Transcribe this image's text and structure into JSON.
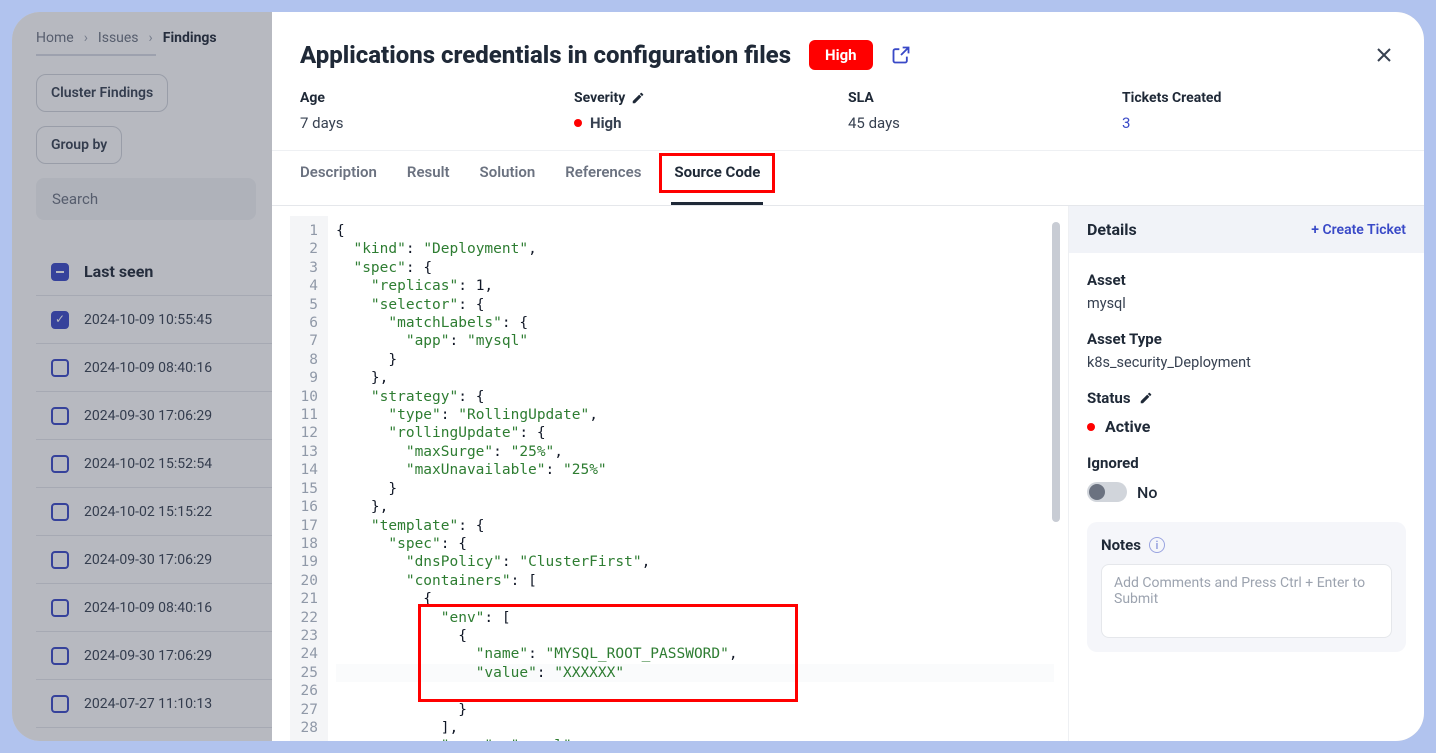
{
  "breadcrumbs": {
    "home": "Home",
    "issues": "Issues",
    "findings": "Findings"
  },
  "bg": {
    "cluster_btn": "Cluster Findings",
    "groupby_btn": "Group by",
    "search_placeholder": "Search",
    "th_lastseen": "Last seen",
    "rows": [
      "2024-10-09 10:55:45",
      "2024-10-09 08:40:16",
      "2024-09-30 17:06:29",
      "2024-10-02 15:52:54",
      "2024-10-02 15:15:22",
      "2024-09-30 17:06:29",
      "2024-10-09 08:40:16",
      "2024-09-30 17:06:29",
      "2024-07-27 11:10:13"
    ]
  },
  "panel": {
    "title": "Applications credentials in configuration files",
    "badge": "High",
    "meta": {
      "age_label": "Age",
      "age_value": "7 days",
      "sev_label": "Severity",
      "sev_value": "High",
      "sla_label": "SLA",
      "sla_value": "45 days",
      "tickets_label": "Tickets Created",
      "tickets_value": "3"
    },
    "tabs": {
      "description": "Description",
      "result": "Result",
      "solution": "Solution",
      "references": "References",
      "source": "Source Code"
    }
  },
  "sidebar": {
    "details": "Details",
    "create_ticket": "+ Create Ticket",
    "asset_label": "Asset",
    "asset_value": "mysql",
    "asset_type_label": "Asset Type",
    "asset_type_value": "k8s_security_Deployment",
    "status_label": "Status",
    "status_value": "Active",
    "ignored_label": "Ignored",
    "ignored_value": "No",
    "notes_label": "Notes",
    "notes_placeholder": "Add Comments and Press Ctrl + Enter to Submit"
  },
  "code": {
    "lines": [
      "{",
      "  \"kind\": \"Deployment\",",
      "  \"spec\": {",
      "    \"replicas\": 1,",
      "    \"selector\": {",
      "      \"matchLabels\": {",
      "        \"app\": \"mysql\"",
      "      }",
      "    },",
      "    \"strategy\": {",
      "      \"type\": \"RollingUpdate\",",
      "      \"rollingUpdate\": {",
      "        \"maxSurge\": \"25%\",",
      "        \"maxUnavailable\": \"25%\"",
      "      }",
      "    },",
      "    \"template\": {",
      "      \"spec\": {",
      "        \"dnsPolicy\": \"ClusterFirst\",",
      "        \"containers\": [",
      "          {",
      "            \"env\": [",
      "              {",
      "                \"name\": \"MYSQL_ROOT_PASSWORD\",",
      "                \"value\": \"XXXXXX\"",
      "              }",
      "            ],",
      "            \"name\": \"mysql\","
    ],
    "highlight_line_index": 24
  }
}
